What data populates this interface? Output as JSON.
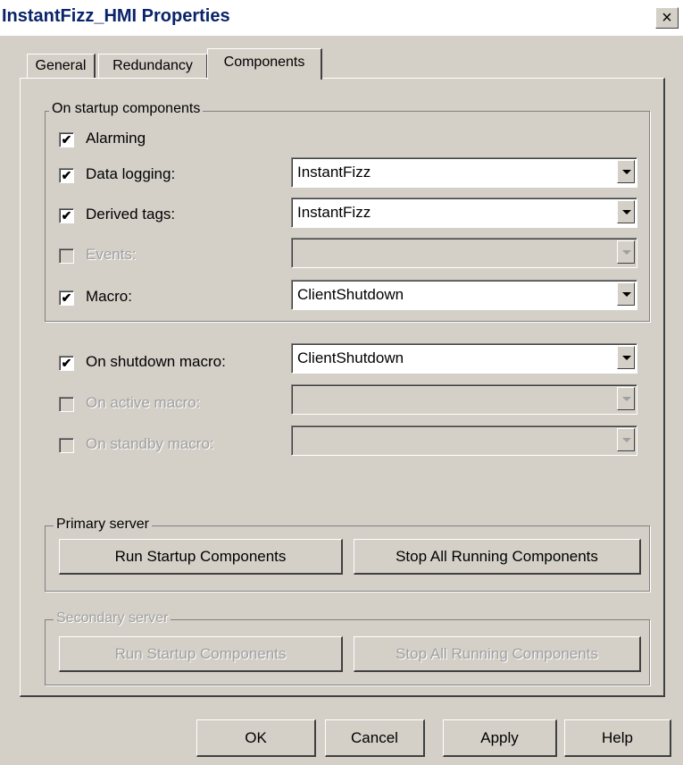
{
  "window": {
    "title": "InstantFizz_HMI Properties",
    "close_glyph": "×"
  },
  "tabs": [
    {
      "label": "General",
      "active": false
    },
    {
      "label": "Redundancy",
      "active": false
    },
    {
      "label": "Components",
      "active": true
    }
  ],
  "startup_group": {
    "legend": "On startup components",
    "rows": [
      {
        "label": "Alarming",
        "checked": true,
        "enabled": true
      },
      {
        "label": "Data logging:",
        "checked": true,
        "enabled": true,
        "value": "InstantFizz"
      },
      {
        "label": "Derived tags:",
        "checked": true,
        "enabled": true,
        "value": "InstantFizz"
      },
      {
        "label": "Events:",
        "checked": false,
        "enabled": false,
        "value": ""
      },
      {
        "label": "Macro:",
        "checked": true,
        "enabled": true,
        "value": "ClientShutdown"
      }
    ]
  },
  "macros": [
    {
      "label": "On shutdown macro:",
      "checked": true,
      "enabled": true,
      "value": "ClientShutdown"
    },
    {
      "label": "On active macro:",
      "checked": false,
      "enabled": false,
      "value": ""
    },
    {
      "label": "On standby macro:",
      "checked": false,
      "enabled": false,
      "value": ""
    }
  ],
  "primary_server": {
    "legend": "Primary server",
    "run_label": "Run Startup Components",
    "stop_label": "Stop All Running Components"
  },
  "secondary_server": {
    "legend": "Secondary server",
    "run_label": "Run Startup Components",
    "stop_label": "Stop All Running Components",
    "enabled": false
  },
  "footer": {
    "ok": "OK",
    "cancel": "Cancel",
    "apply": "Apply",
    "help": "Help"
  },
  "check_glyph": "✔"
}
